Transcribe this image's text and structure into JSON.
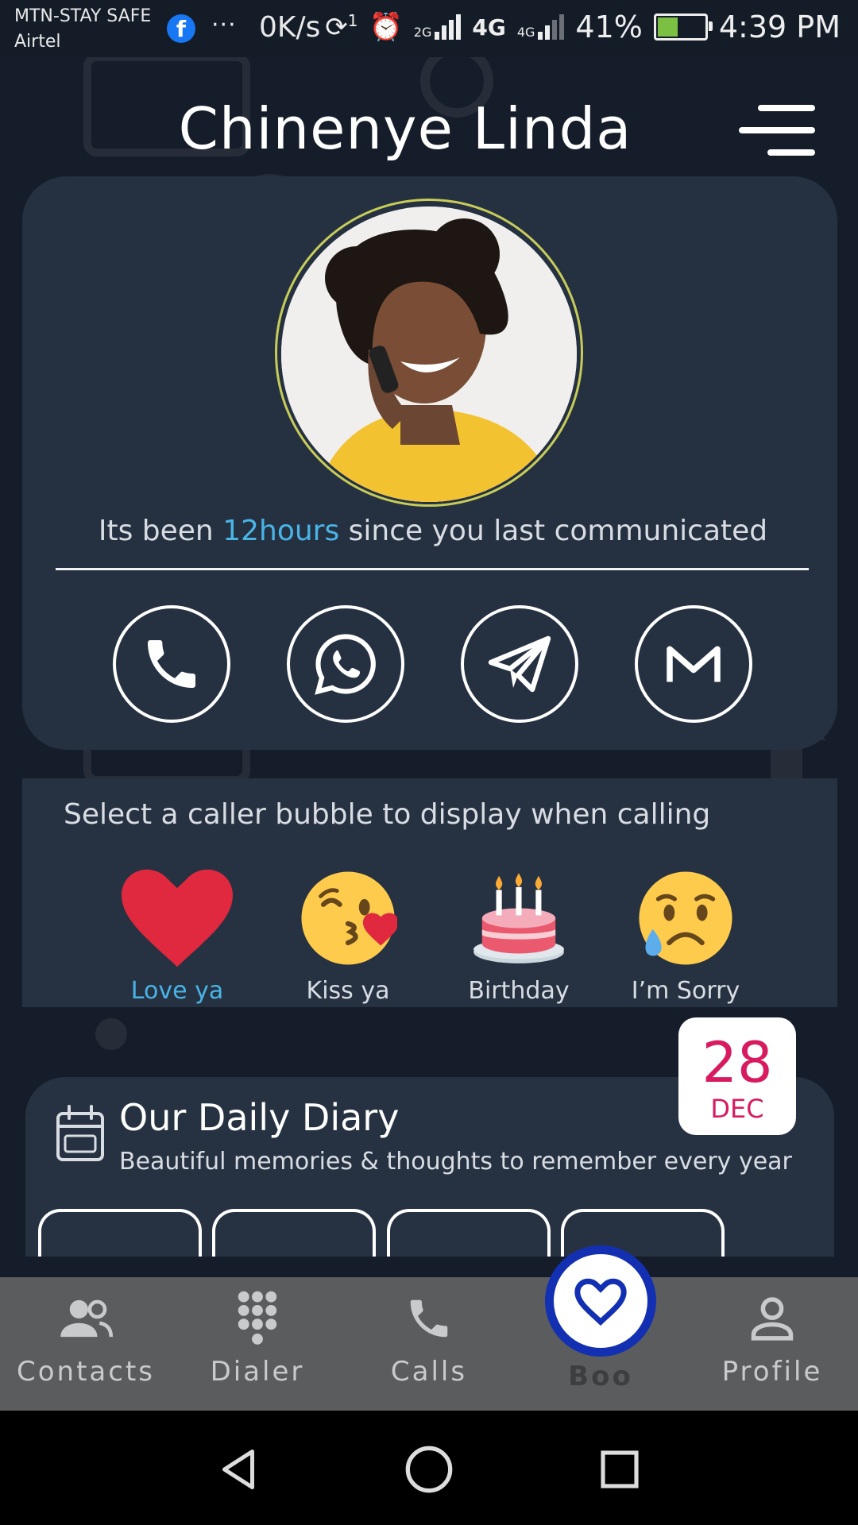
{
  "status_bar": {
    "carrier_1": "MTN-STAY SAFE",
    "carrier_2": "Airtel",
    "notification_dots": "···",
    "net_speed": "0K/s",
    "sim_badge": "1",
    "network_2g": "2G",
    "network_4g": "4G",
    "network_4g_small": "4G",
    "battery": "41%",
    "time": "4:39 PM"
  },
  "header": {
    "title": "Chinenye Linda"
  },
  "profile": {
    "comm_prefix": "Its been ",
    "comm_highlight": "12hours",
    "comm_suffix": " since you last communicated",
    "contact_buttons": [
      "phone-icon",
      "whatsapp-icon",
      "telegram-icon",
      "gmail-icon"
    ]
  },
  "bubbles": {
    "title": "Select a caller bubble to display when calling",
    "items": [
      {
        "label": "Love ya",
        "icon": "heart-icon",
        "selected": true
      },
      {
        "label": "Kiss ya",
        "icon": "kiss-emoji-icon",
        "selected": false
      },
      {
        "label": "Birthday",
        "icon": "cake-icon",
        "selected": false
      },
      {
        "label": "I’m Sorry",
        "icon": "sad-emoji-icon",
        "selected": false
      }
    ]
  },
  "diary": {
    "title": "Our Daily Diary",
    "subtitle": "Beautiful memories & thoughts to remember every year",
    "date_day": "28",
    "date_month": "DEC"
  },
  "bottom_nav": {
    "items": [
      {
        "label": "Contacts",
        "icon": "contacts-icon"
      },
      {
        "label": "Dialer",
        "icon": "dialpad-icon"
      },
      {
        "label": "Calls",
        "icon": "phone-icon"
      },
      {
        "label": "Boo",
        "icon": "heart-icon",
        "active": true
      },
      {
        "label": "Profile",
        "icon": "person-icon"
      }
    ]
  },
  "colors": {
    "background": "#151d2a",
    "card": "#253141",
    "accent": "#49b4e6",
    "boo_ring": "#1330b2",
    "date_text": "#d81b60"
  }
}
